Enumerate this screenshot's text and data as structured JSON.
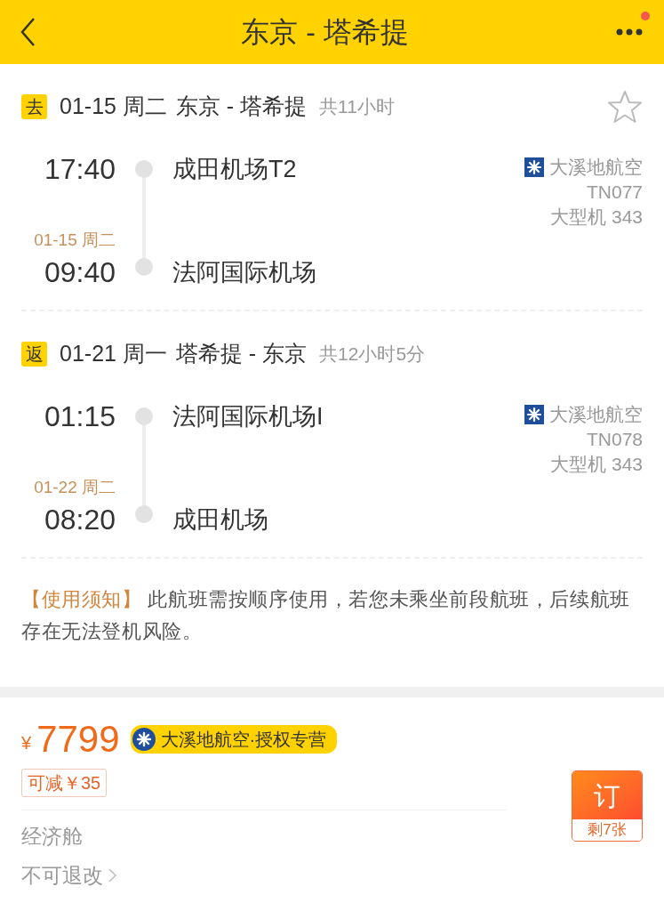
{
  "header": {
    "title": "东京 - 塔希提"
  },
  "segments": [
    {
      "tag": "去",
      "date": "01-15 周二",
      "route": "东京 - 塔希提",
      "duration": "共11小时",
      "depart_time": "17:40",
      "depart_airport": "成田机场T2",
      "arrive_date": "01-15 周二",
      "arrive_time": "09:40",
      "arrive_airport": "法阿国际机场",
      "airline": "大溪地航空",
      "flight_no": "TN077",
      "aircraft": "大型机 343"
    },
    {
      "tag": "返",
      "date": "01-21 周一",
      "route": "塔希提 - 东京",
      "duration": "共12小时5分",
      "depart_time": "01:15",
      "depart_airport": "法阿国际机场I",
      "arrive_date": "01-22 周二",
      "arrive_time": "08:20",
      "arrive_airport": "成田机场",
      "airline": "大溪地航空",
      "flight_no": "TN078",
      "aircraft": "大型机 343"
    }
  ],
  "notice": {
    "label": "【使用须知】",
    "text": "此航班需按顺序使用，若您未乘坐前段航班，后续航班存在无法登机风险。"
  },
  "offer": {
    "currency": "¥",
    "price": "7799",
    "badge": "大溪地航空·授权专营",
    "discount": "可减￥35",
    "cabin": "经济舱",
    "refund": "不可退改",
    "book_label": "订",
    "remaining": "剩7张"
  }
}
